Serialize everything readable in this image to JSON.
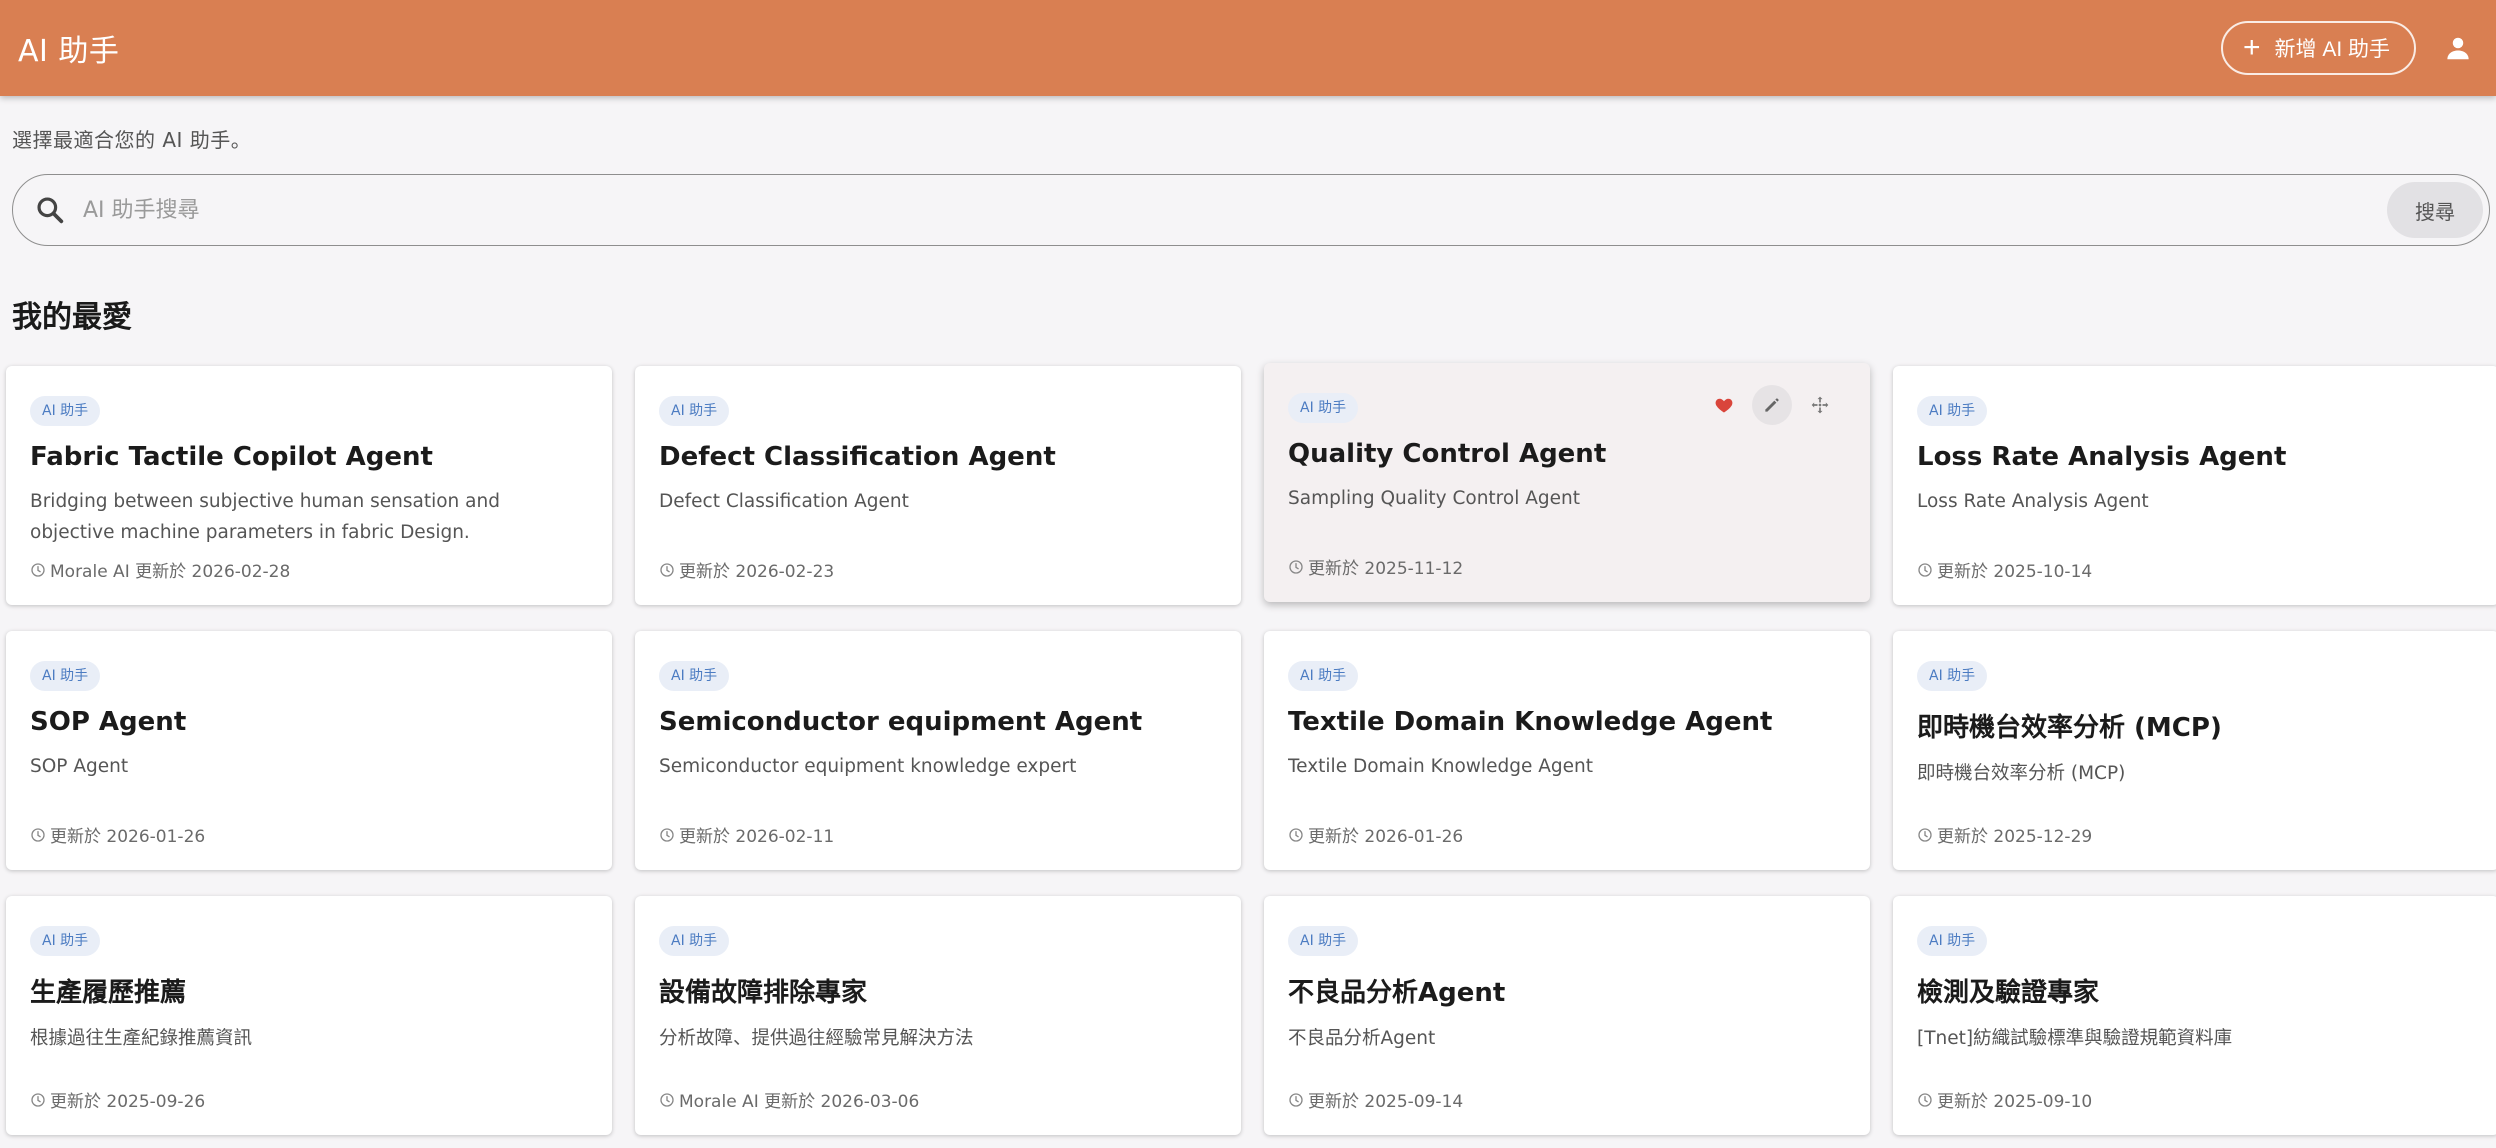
{
  "header": {
    "title": "AI 助手",
    "add_button_label": "新增 AI 助手",
    "color": "#d97f52"
  },
  "subtitle": "選擇最適合您的 AI 助手。",
  "search": {
    "placeholder": "AI 助手搜尋",
    "value": "",
    "button_label": "搜尋"
  },
  "favorites": {
    "title": "我的最愛",
    "cards": [
      {
        "tag": "AI 助手",
        "title": "Fabric Tactile Copilot Agent",
        "description": "Bridging between subjective human sensation and objective machine parameters in fabric Design.",
        "meta": "Morale AI 更新於 2026-02-28"
      },
      {
        "tag": "AI 助手",
        "title": "Defect Classification Agent",
        "description": "Defect Classification Agent",
        "meta": "更新於 2026-02-23"
      },
      {
        "tag": "AI 助手",
        "title": "Quality Control Agent",
        "description": "Sampling Quality Control Agent",
        "meta": "更新於 2025-11-12",
        "hovered": true
      },
      {
        "tag": "AI 助手",
        "title": "Loss Rate Analysis Agent",
        "description": "Loss Rate Analysis Agent",
        "meta": "更新於 2025-10-14"
      },
      {
        "tag": "AI 助手",
        "title": "SOP Agent",
        "description": "SOP Agent",
        "meta": "更新於 2026-01-26"
      },
      {
        "tag": "AI 助手",
        "title": "Semiconductor equipment Agent",
        "description": "Semiconductor equipment knowledge expert",
        "meta": "更新於 2026-02-11"
      },
      {
        "tag": "AI 助手",
        "title": "Textile Domain Knowledge Agent",
        "description": "Textile Domain Knowledge Agent",
        "meta": "更新於 2026-01-26"
      },
      {
        "tag": "AI 助手",
        "title": "即時機台效率分析 (MCP)",
        "description": "即時機台效率分析 (MCP)",
        "meta": "更新於 2025-12-29"
      },
      {
        "tag": "AI 助手",
        "title": "生產履歷推薦",
        "description": "根據過往生產紀錄推薦資訊",
        "meta": "更新於 2025-09-26"
      },
      {
        "tag": "AI 助手",
        "title": "設備故障排除專家",
        "description": "分析故障、提供過往經驗常見解決方法",
        "meta": "Morale AI 更新於 2026-03-06"
      },
      {
        "tag": "AI 助手",
        "title": "不良品分析Agent",
        "description": "不良品分析Agent",
        "meta": "更新於 2025-09-14"
      },
      {
        "tag": "AI 助手",
        "title": "檢測及驗證專家",
        "description": "[Tnet]紡織試驗標準與驗證規範資料庫",
        "meta": "更新於 2025-09-10"
      }
    ]
  }
}
